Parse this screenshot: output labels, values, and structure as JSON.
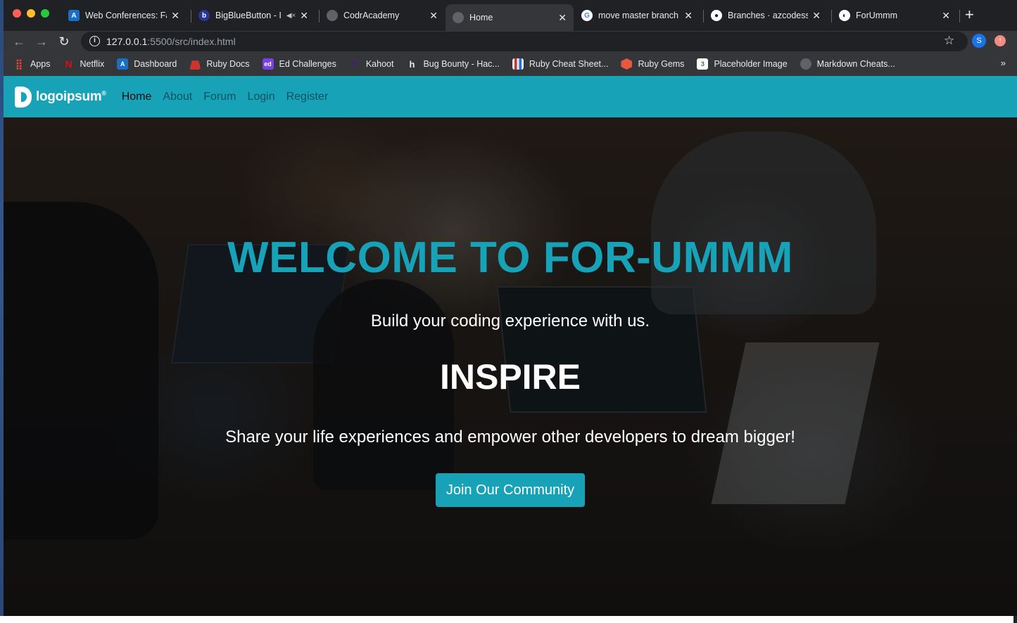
{
  "browser": {
    "tabs": [
      {
        "title": "Web Conferences: Fa",
        "icon": "canvas-icon",
        "color": "#1a6fc4"
      },
      {
        "title": "BigBlueButton - I",
        "icon": "bigbluebutton-icon",
        "color": "#283593",
        "muted": true
      },
      {
        "title": "CodrAcademy",
        "icon": "globe-icon",
        "color": "#5f6368"
      },
      {
        "title": "Home",
        "icon": "globe-icon",
        "color": "#5f6368",
        "active": true
      },
      {
        "title": "move master branch",
        "icon": "google-icon",
        "color": "#ffffff"
      },
      {
        "title": "Branches · azcodess",
        "icon": "github-icon",
        "color": "#ffffff"
      },
      {
        "title": "ForUmmm",
        "icon": "globe-icon",
        "color": "#ffffff"
      }
    ],
    "url_host": "127.0.0.1",
    "url_path": ":5500/src/index.html",
    "profile_initial": "S",
    "bookmarks": [
      {
        "label": "Apps",
        "icon": "apps-grid-icon",
        "color": "#ea4335"
      },
      {
        "label": "Netflix",
        "icon": "netflix-icon",
        "color": "#e50914"
      },
      {
        "label": "Dashboard",
        "icon": "canvas-icon",
        "color": "#1a6fc4"
      },
      {
        "label": "Ruby Docs",
        "icon": "ruby-icon",
        "color": "#cc342d"
      },
      {
        "label": "Ed Challenges",
        "icon": "ed-icon",
        "color": "#7b3fe4"
      },
      {
        "label": "Kahoot",
        "icon": "kahoot-icon",
        "color": "#46178f"
      },
      {
        "label": "Bug Bounty - Hac...",
        "icon": "hackerone-icon",
        "color": "#35363a"
      },
      {
        "label": "Ruby Cheat Sheet...",
        "icon": "stripes-icon",
        "color": "#e8eaed"
      },
      {
        "label": "Ruby Gems",
        "icon": "rubygems-icon",
        "color": "#e9573f"
      },
      {
        "label": "Placeholder Image",
        "icon": "placeholder-icon",
        "color": "#ffffff"
      },
      {
        "label": "Markdown Cheats...",
        "icon": "github-icon",
        "color": "#35363a"
      }
    ],
    "more_bookmarks": "»"
  },
  "site": {
    "logo_text": "logoipsum",
    "logo_mark": "®",
    "nav": [
      {
        "label": "Home",
        "active": true
      },
      {
        "label": "About"
      },
      {
        "label": "Forum"
      },
      {
        "label": "Login"
      },
      {
        "label": "Register"
      }
    ],
    "brand_color": "#17a2b8"
  },
  "hero": {
    "title": "WELCOME TO FOR-UMMM",
    "subtitle": "Build your coding experience with us.",
    "highlight": "INSPIRE",
    "description": "Share your life experiences and empower other developers to dream bigger!",
    "cta_label": "Join Our Community"
  }
}
